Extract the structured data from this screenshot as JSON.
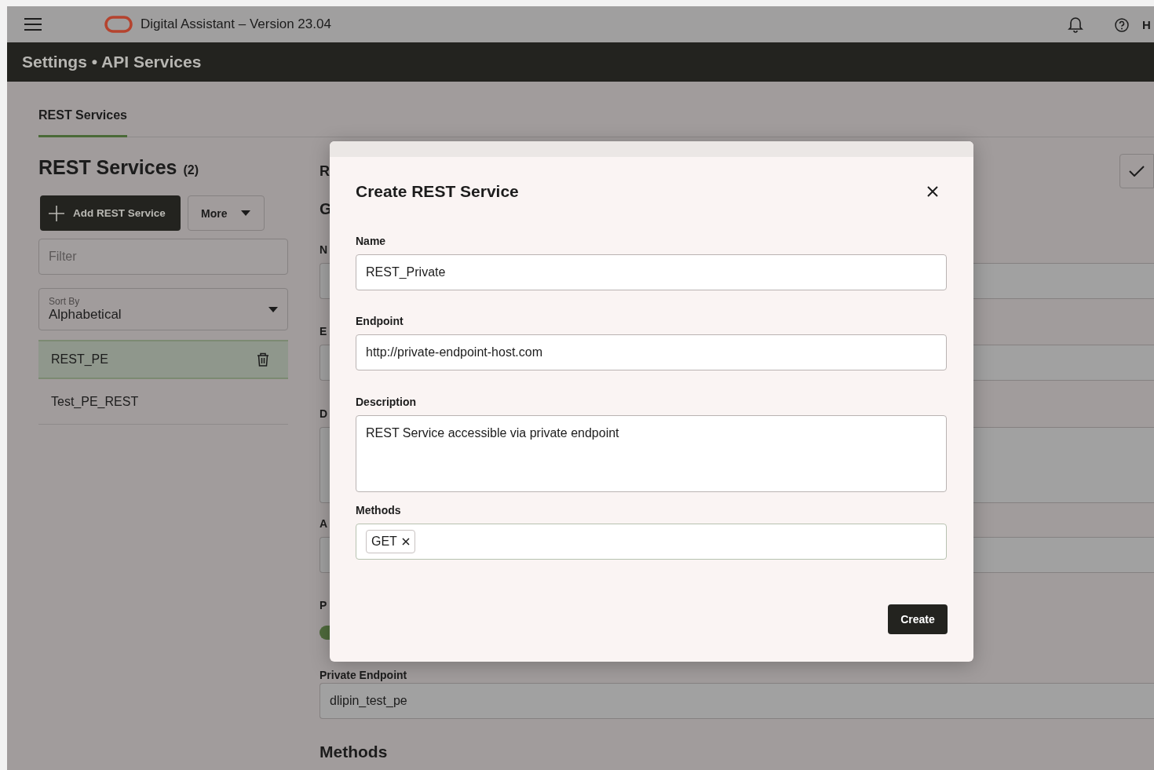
{
  "app_bar": {
    "title": "Digital Assistant – Version 23.04",
    "user_menu": "H"
  },
  "page_title": "Settings • API Services",
  "tabs": [
    {
      "label": "REST Services",
      "selected": true
    }
  ],
  "list_panel": {
    "heading": "REST Services",
    "count": "(2)",
    "add_button": "Add REST Service",
    "more_button": "More",
    "filter": {
      "placeholder": "Filter"
    },
    "sort": {
      "label": "Sort By",
      "value": "Alphabetical"
    },
    "items": [
      {
        "name": "REST_PE",
        "selected": true
      },
      {
        "name": "Test_PE_REST",
        "selected": false
      }
    ]
  },
  "detail_panel": {
    "title": "R",
    "section": "G",
    "field_labels": [
      "N",
      "E",
      "D",
      "A"
    ],
    "toggle": {
      "label": "P",
      "on": true
    },
    "private_endpoint": {
      "label": "Private Endpoint",
      "value": "dlipin_test_pe"
    },
    "methods_heading": "Methods"
  },
  "dialog": {
    "title": "Create REST Service",
    "fields": [
      {
        "kind": "text",
        "label": "Name",
        "value": "REST_Private"
      },
      {
        "kind": "text",
        "label": "Endpoint",
        "value": "http://private-endpoint-host.com"
      },
      {
        "kind": "textarea",
        "label": "Description",
        "value": "REST Service accessible via private endpoint"
      },
      {
        "kind": "chips",
        "label": "Methods",
        "chips": [
          "GET"
        ]
      }
    ],
    "create_button": "Create"
  }
}
